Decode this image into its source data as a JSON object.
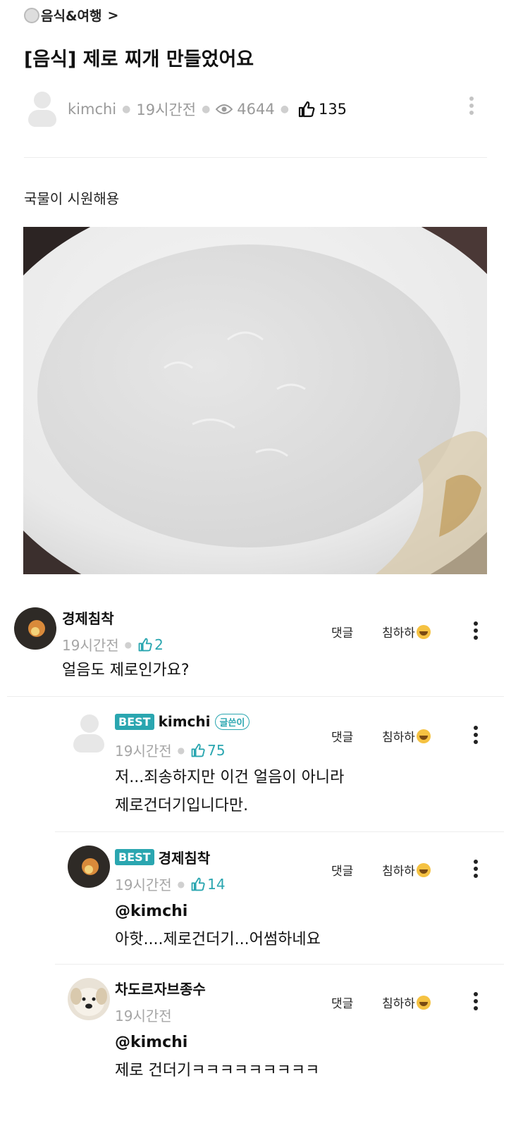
{
  "breadcrumb": {
    "label": "음식&여행",
    "chevron": ">"
  },
  "post": {
    "title": "[음식] 제로 찌개 만들었어요",
    "author": "kimchi",
    "time": "19시간전",
    "views": "4644",
    "likes": "135",
    "body": "국물이 시원해용"
  },
  "actions": {
    "reply": "댓글",
    "laugh": "침하하"
  },
  "comments": [
    {
      "author": "경제침착",
      "time": "19시간전",
      "likes": "2",
      "text": "얼음도 제로인가요?"
    },
    {
      "best": "BEST",
      "author": "kimchi",
      "op_badge": "글쓴이",
      "time": "19시간전",
      "likes": "75",
      "text_line1": "저...죄송하지만 이건 얼음이 아니라",
      "text_line2": "제로건더기입니다만."
    },
    {
      "best": "BEST",
      "author": "경제침착",
      "time": "19시간전",
      "likes": "14",
      "mention": "@kimchi",
      "text": "아핫....제로건더기...어썸하네요"
    },
    {
      "author": "차도르자브종수",
      "time": "19시간전",
      "mention": "@kimchi",
      "text": "제로 건더기ㅋㅋㅋㅋㅋㅋㅋㅋㅋ"
    }
  ],
  "colors": {
    "accent": "#2aa6b0",
    "muted": "#9a9a9a"
  }
}
